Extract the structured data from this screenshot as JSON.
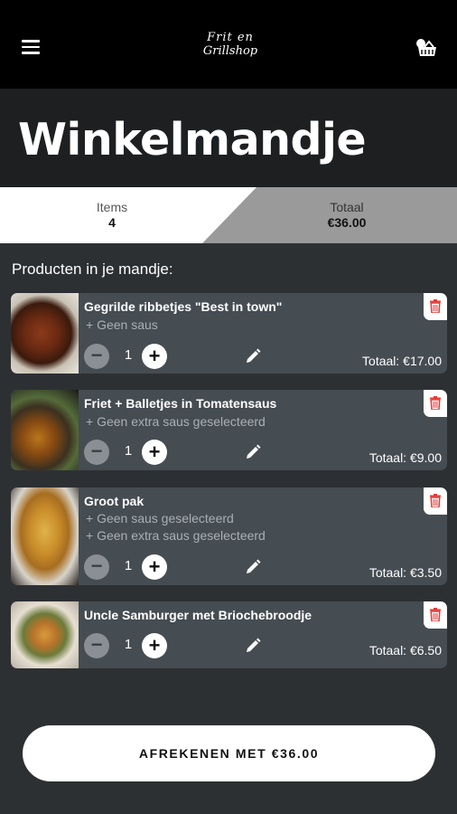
{
  "logo": {
    "line1": "Frit en",
    "line2": "Grillshop"
  },
  "page_title": "Winkelmandje",
  "tabs": {
    "items": {
      "label": "Items",
      "value": "4"
    },
    "total": {
      "label": "Totaal",
      "value": "€36.00"
    }
  },
  "section_label": "Producten in je mandje:",
  "products": [
    {
      "name": "Gegrilde ribbetjes \"Best in town\"",
      "options": [
        "+ Geen saus"
      ],
      "qty": "1",
      "total": "Totaal: €17.00"
    },
    {
      "name": "Friet + Balletjes in Tomatensaus",
      "options": [
        "+ Geen extra saus geselecteerd"
      ],
      "qty": "1",
      "total": "Totaal: €9.00"
    },
    {
      "name": "Groot pak",
      "options": [
        "+ Geen saus geselecteerd",
        "+ Geen extra saus geselecteerd"
      ],
      "qty": "1",
      "total": "Totaal: €3.50"
    },
    {
      "name": "Uncle Samburger met Briochebroodje",
      "options": [],
      "qty": "1",
      "total": "Totaal: €6.50"
    }
  ],
  "checkout_label": "AFREKENEN MET €36.00",
  "icons": {
    "menu": "menu-icon",
    "cart": "cart-icon",
    "edit": "pencil-icon",
    "delete": "trash-icon"
  },
  "colors": {
    "delete_accent": "#e53935",
    "card_bg": "#454c52"
  }
}
